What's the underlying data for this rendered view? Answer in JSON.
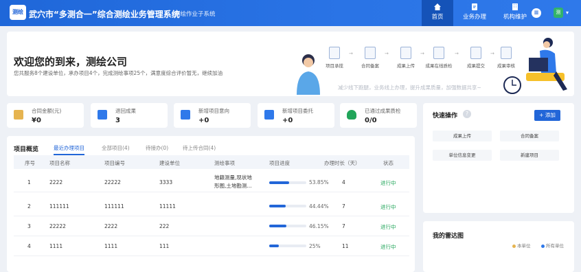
{
  "header": {
    "logo_text": "测绘",
    "title": "武穴市“多测合一”综合测绘业务管理系统",
    "subtitle": "测绘作业子系统",
    "nav": [
      {
        "label": "首页",
        "icon": "home-icon"
      },
      {
        "label": "业务办理",
        "icon": "edit-document-icon"
      },
      {
        "label": "机构维护",
        "icon": "building-icon"
      }
    ],
    "user_badge": "测"
  },
  "banner": {
    "welcome": "欢迎您的到来，测绘公司",
    "summary": "您共服务8个建设单位，承办项目4个，完成测绘事项25个，满意度综合评价暂无，继续加油",
    "flow_steps": [
      "项目承揽",
      "合同备案",
      "成果上传",
      "成果在线质检",
      "成果提交",
      "成果审核"
    ],
    "slogan": "减少线下跑腿，业务线上办理，提升成果质量，加强数据共享~"
  },
  "stats": [
    {
      "label": "合同金额(元)",
      "value": "¥0",
      "color": "#e6b450"
    },
    {
      "label": "退回成果",
      "value": "3",
      "color": "#2f79ea"
    },
    {
      "label": "新增项目意向",
      "value": "+0",
      "color": "#2f79ea"
    },
    {
      "label": "新增项目委托",
      "value": "+0",
      "color": "#2f79ea"
    },
    {
      "label": "已通过成果质检",
      "value": "0/0",
      "color": "#21a55a"
    }
  ],
  "overview": {
    "title": "项目概览",
    "tabs": [
      "最近办理项目",
      "全部项目(4)",
      "待接办(0)",
      "待上传合同(4)"
    ],
    "columns": [
      "序号",
      "项目名称",
      "项目编号",
      "建设单位",
      "测绘事项",
      "项目进度",
      "办理时长（天）",
      "状态"
    ],
    "rows": [
      {
        "no": "1",
        "name": "2222",
        "code": "22222",
        "unit": "3333",
        "items_1": "地籍测量,现状地",
        "items_2": "形图,土地勘测...",
        "progress": 53.85,
        "pct": "53.85%",
        "days": "4",
        "status": "进行中"
      },
      {
        "no": "2",
        "name": "111111",
        "code": "111111",
        "unit": "11111",
        "items_1": "",
        "items_2": "",
        "progress": 44.44,
        "pct": "44.44%",
        "days": "7",
        "status": "进行中"
      },
      {
        "no": "3",
        "name": "22222",
        "code": "2222",
        "unit": "222",
        "items_1": "",
        "items_2": "",
        "progress": 46.15,
        "pct": "46.15%",
        "days": "7",
        "status": "进行中"
      },
      {
        "no": "4",
        "name": "1111",
        "code": "1111",
        "unit": "111",
        "items_1": "",
        "items_2": "",
        "progress": 25,
        "pct": "25%",
        "days": "11",
        "status": "进行中"
      }
    ]
  },
  "quick": {
    "title": "快速操作",
    "help": "?",
    "add_label": "+ 添加",
    "actions": [
      "成果上传",
      "合同备案",
      "单位信息变更",
      "新建项目"
    ]
  },
  "radar": {
    "title": "我的雷达图",
    "legend": [
      "本单位",
      "所有单位"
    ]
  },
  "colors": {
    "primary": "#2266d8",
    "success": "#21a55a",
    "warning": "#e6b450"
  }
}
